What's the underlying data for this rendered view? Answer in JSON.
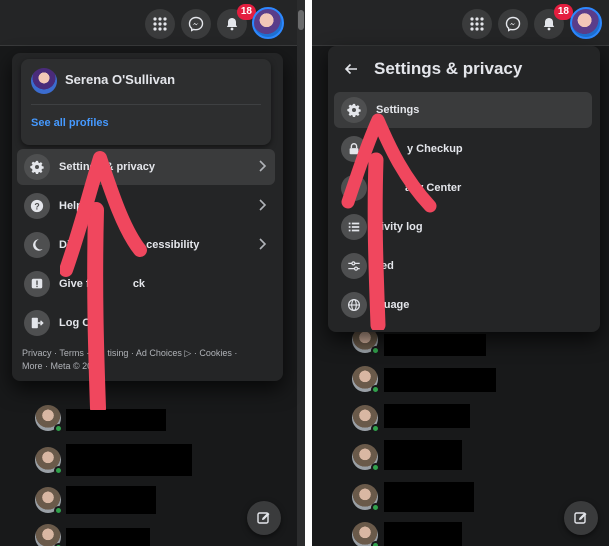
{
  "left_panel": {
    "topbar": {
      "icons": [
        "menu-grid-icon",
        "messenger-icon",
        "notifications-bell-icon"
      ],
      "notification_badge": "18"
    },
    "account_menu": {
      "profile_name": "Serena O'Sullivan",
      "see_all_profiles": "See all profiles",
      "items": [
        {
          "label": "Settings & privacy",
          "icon": "gear-icon",
          "has_chevron": true
        },
        {
          "label": "Help & ",
          "icon": "help-icon",
          "has_chevron": true
        },
        {
          "label": "Dis",
          "label_tail": "cessibility",
          "icon": "moon-icon",
          "has_chevron": true
        },
        {
          "label": "Give fee",
          "label_tail": "ck",
          "icon": "feedback-icon",
          "has_chevron": false
        },
        {
          "label": "Log Out",
          "icon": "logout-icon",
          "has_chevron": false
        }
      ],
      "footer_line1_a": "Privacy · Terms · A",
      "footer_line1_b": "tising · Ad Choices",
      "footer_line1_c": " · Cookies ·",
      "footer_line2": "More · Meta © 20"
    }
  },
  "right_panel": {
    "topbar": {
      "icons": [
        "menu-grid-icon",
        "messenger-icon",
        "notifications-bell-icon"
      ],
      "notification_badge": "18"
    },
    "settings_menu": {
      "title": "Settings & privacy",
      "items": [
        {
          "label": "Settings",
          "icon": "gear-icon"
        },
        {
          "label": "y Checkup",
          "icon": "lock-icon"
        },
        {
          "label": "acy Center",
          "icon": "privacy-center-icon"
        },
        {
          "label": "ivity log",
          "icon": "list-icon"
        },
        {
          "label": "ed",
          "icon": "sliders-icon"
        },
        {
          "label": "guage",
          "icon": "globe-icon"
        }
      ]
    }
  },
  "colors": {
    "background": "#18191a",
    "surface": "#242526",
    "link": "#4599ff",
    "badge": "#e41e3f",
    "annotation_arrow": "#f0475e",
    "online_dot": "#31a24c"
  }
}
